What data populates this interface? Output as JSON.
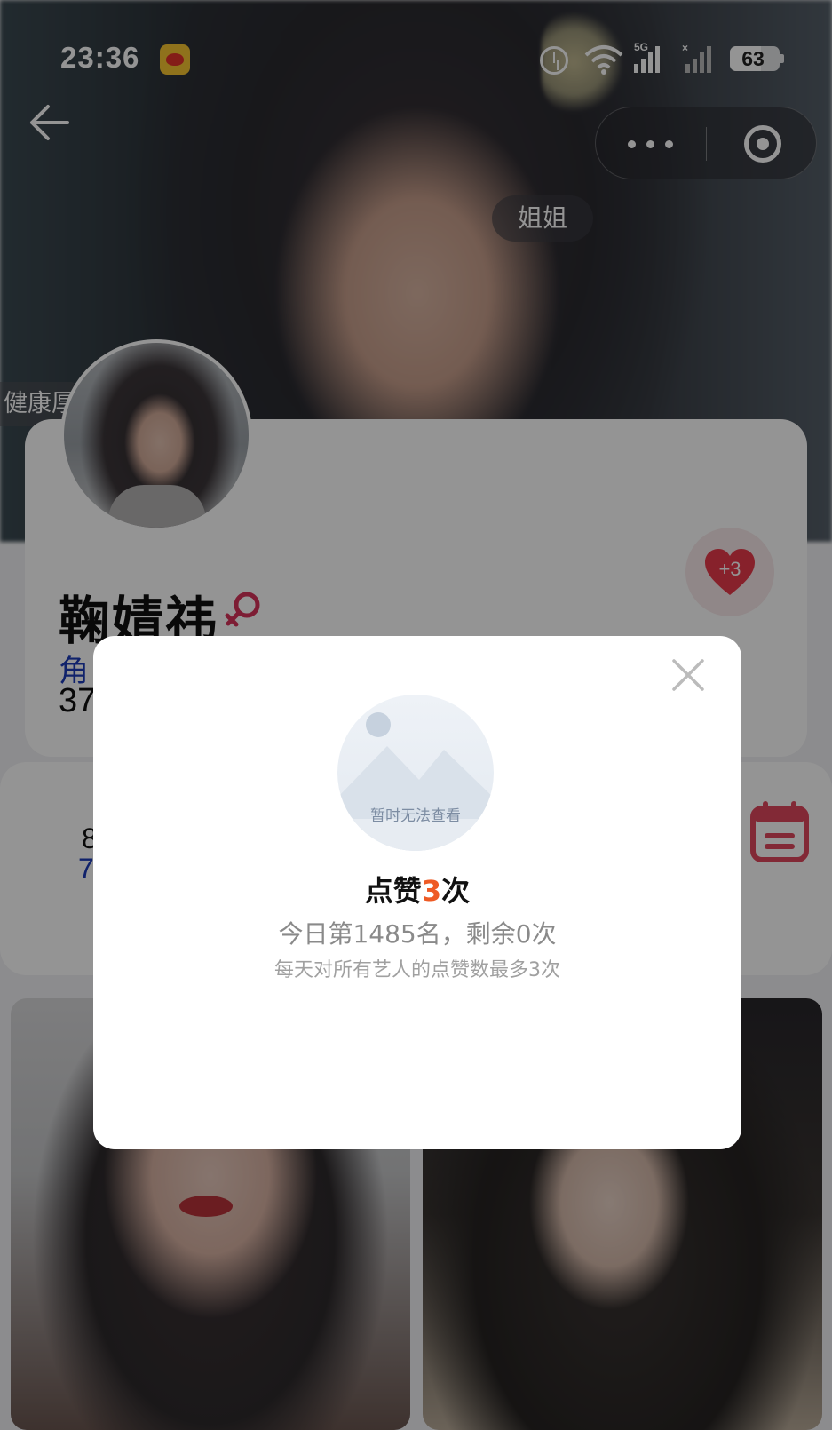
{
  "status_bar": {
    "time": "23:36",
    "network_label": "5G",
    "battery": "63",
    "battery_level": 0.63,
    "icons": [
      "weibo-icon",
      "alarm-icon",
      "wifi-icon",
      "signal-5g-icon",
      "signal-no-service-icon",
      "battery-icon"
    ]
  },
  "nav": {
    "back_icon": "arrow-left-icon",
    "more_icon": "more-dots-icon",
    "close_icon": "target-circle-icon"
  },
  "hero": {
    "nickname_tag": "姐姐",
    "side_tag": "健康厚"
  },
  "profile": {
    "name": "鞠婧祎",
    "gender_icon": "female-symbol-icon",
    "role_partial": "角",
    "count_partial": "37",
    "like_badge": "+3",
    "accent_color": "#e83a4a"
  },
  "stats": {
    "value1_partial": "8",
    "value2_partial": "7"
  },
  "modal": {
    "image_caption": "暂时无法查看",
    "title_prefix": "点赞",
    "title_count": "3",
    "title_suffix": "次",
    "rank_text": "今日第1485名，剩余0次",
    "rule_text": "每天对所有艺人的点赞数最多3次",
    "highlight_color": "#ee5a24"
  }
}
